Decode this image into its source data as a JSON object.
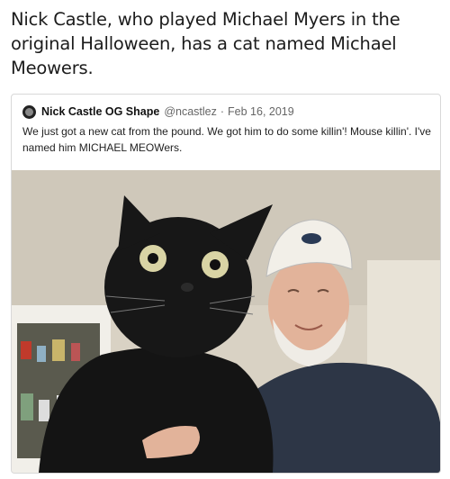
{
  "caption": "Nick Castle, who played Michael Myers in the original Halloween, has a cat named Michael Meowers.",
  "tweet": {
    "display_name": "Nick Castle OG Shape",
    "handle": "@ncastlez",
    "separator": "·",
    "date": "Feb 16, 2019",
    "text": "We just got a new cat from the pound. We got him to do some killin'! Mouse killin'. I've named him MICHAEL MEOWers."
  }
}
